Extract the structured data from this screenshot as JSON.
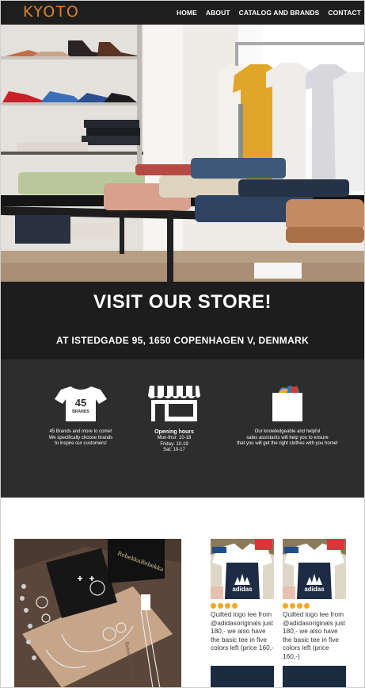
{
  "brand": {
    "logo_text": "KYOTO",
    "accent": "#d9822b"
  },
  "nav": {
    "items": [
      "HOME",
      "ABOUT",
      "CATALOG AND BRANDS",
      "CONTACT"
    ]
  },
  "visit": {
    "title": "VISIT OUR STORE!",
    "address": "AT ISTEDGADE 95, 1650 COPENHAGEN V, DENMARK"
  },
  "features": [
    {
      "icon": "tshirt-icon",
      "icon_text": [
        "45",
        "BRANDS"
      ],
      "title": "",
      "lines": [
        "45 Brands and more to come!",
        "We specifically choose brands",
        "to inspire our customers!"
      ]
    },
    {
      "icon": "storefront-icon",
      "title": "Opening hours",
      "lines": [
        "Mon-thur: 10-18",
        "Friday: 10-19",
        "Sat: 10-17"
      ]
    },
    {
      "icon": "shopping-bag-icon",
      "title": "",
      "lines": [
        "Our knowledgeable and helpful",
        "sales assistants will help you to ensure",
        "that you will get the right clothes with you home!"
      ]
    }
  ],
  "instagram": {
    "posts": [
      {
        "text": "Quilted logo tee from @adidasoriginals just 180,- we also have the basic tee in five colors left (price 160,-"
      },
      {
        "text": "Quilted logo tee from @adidasoriginals just 180,- we also have the basic tee in five colors left (price 160,-)"
      }
    ],
    "box_brand": "RebekkaRebekka"
  }
}
